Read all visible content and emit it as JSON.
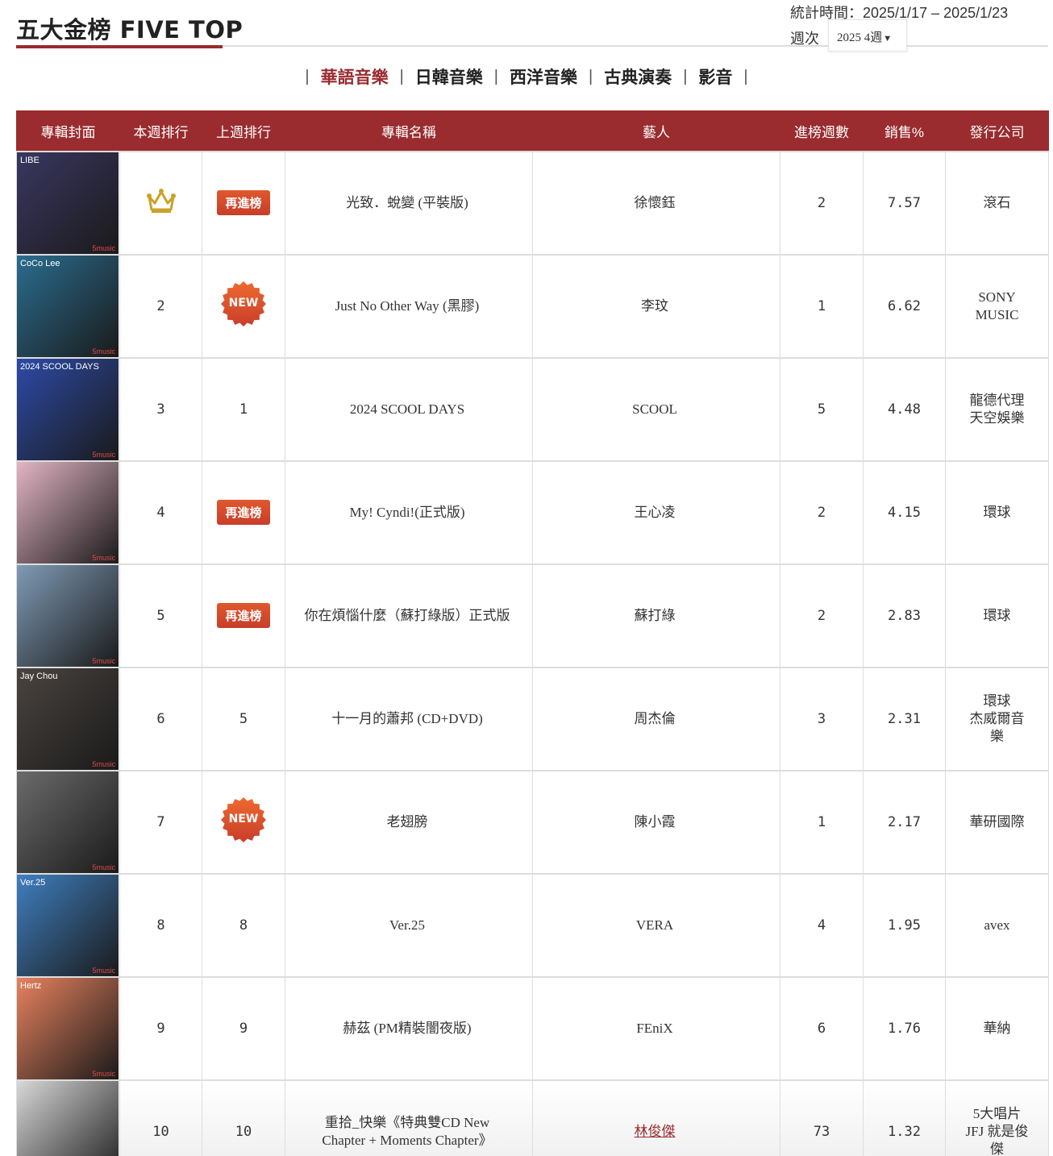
{
  "page": {
    "title": "五大金榜 FIVE TOP",
    "stat_period": "統計時間：2025/1/17 – 2025/1/23",
    "week_label": "週次",
    "week_value": "2025 4週"
  },
  "tabs": [
    {
      "label": "華語音樂",
      "active": true
    },
    {
      "label": "日韓音樂",
      "active": false
    },
    {
      "label": "西洋音樂",
      "active": false
    },
    {
      "label": "古典演奏",
      "active": false
    },
    {
      "label": "影音",
      "active": false
    }
  ],
  "tab_separator": "|",
  "table": {
    "headers": [
      "專輯封面",
      "本週排行",
      "上週排行",
      "專輯名稱",
      "藝人",
      "進榜週數",
      "銷售%",
      "發行公司"
    ],
    "badges": {
      "reentry": "再進榜",
      "new": "NEW"
    },
    "rows": [
      {
        "rank": "",
        "rank_icon": "crown-icon",
        "last": "",
        "last_badge": "reentry",
        "album": "光致．蛻變 (平裝版)",
        "artist": "徐懷鈺",
        "weeks": "2",
        "sales": "7.57",
        "label": [
          "滾石"
        ],
        "cover_color": "#3a3760",
        "cover_caption": "LIBE",
        "artist_link": false
      },
      {
        "rank": "2",
        "last": "",
        "last_badge": "new",
        "album": "Just No Other Way (黑膠)",
        "artist": "李玟",
        "weeks": "1",
        "sales": "6.62",
        "label": [
          "SONY",
          "MUSIC"
        ],
        "cover_color": "#2a6d8f",
        "cover_caption": "CoCo Lee",
        "artist_link": false
      },
      {
        "rank": "3",
        "last": "1",
        "last_badge": "",
        "album": "2024 SCOOL DAYS",
        "artist": "SCOOL",
        "weeks": "5",
        "sales": "4.48",
        "label": [
          "龍德代理",
          "天空娛樂"
        ],
        "cover_color": "#2d4aa8",
        "cover_caption": "2024 SCOOL DAYS",
        "artist_link": false
      },
      {
        "rank": "4",
        "last": "",
        "last_badge": "reentry",
        "album": "My! Cyndi!(正式版)",
        "artist": "王心凌",
        "weeks": "2",
        "sales": "4.15",
        "label": [
          "環球"
        ],
        "cover_color": "#e3b5c4",
        "cover_caption": "",
        "artist_link": false
      },
      {
        "rank": "5",
        "last": "",
        "last_badge": "reentry",
        "album": "你在煩惱什麼（蘇打綠版）正式版",
        "artist": "蘇打綠",
        "weeks": "2",
        "sales": "2.83",
        "label": [
          "環球"
        ],
        "cover_color": "#7f9bb5",
        "cover_caption": "",
        "artist_link": false
      },
      {
        "rank": "6",
        "last": "5",
        "last_badge": "",
        "album": "十一月的蕭邦 (CD+DVD)",
        "artist": "周杰倫",
        "weeks": "3",
        "sales": "2.31",
        "label": [
          "環球",
          "杰威爾音",
          "樂"
        ],
        "cover_color": "#4a4440",
        "cover_caption": "Jay Chou",
        "artist_link": false
      },
      {
        "rank": "7",
        "last": "",
        "last_badge": "new",
        "album": "老翅膀",
        "artist": "陳小霞",
        "weeks": "1",
        "sales": "2.17",
        "label": [
          "華研國際"
        ],
        "cover_color": "#6b6b6b",
        "cover_caption": "",
        "artist_link": false
      },
      {
        "rank": "8",
        "last": "8",
        "last_badge": "",
        "album": "Ver.25",
        "artist": "VERA",
        "weeks": "4",
        "sales": "1.95",
        "label": [
          "avex"
        ],
        "cover_color": "#3f7fc0",
        "cover_caption": "Ver.25",
        "artist_link": false
      },
      {
        "rank": "9",
        "last": "9",
        "last_badge": "",
        "album": "赫茲 (PM精裝闇夜版)",
        "artist": "FEniX",
        "weeks": "6",
        "sales": "1.76",
        "label": [
          "華納"
        ],
        "cover_color": "#e8825e",
        "cover_caption": "Hertz",
        "artist_link": false
      },
      {
        "rank": "10",
        "last": "10",
        "last_badge": "",
        "album": "重拾_快樂《特典雙CD New Chapter + Moments Chapter》",
        "artist": "林俊傑",
        "weeks": "73",
        "sales": "1.32",
        "label": [
          "5大唱片",
          "JFJ 就是俊",
          "傑"
        ],
        "cover_color": "#d8d8d8",
        "cover_caption": "",
        "artist_link": true
      }
    ]
  },
  "cover_brand": "5music"
}
